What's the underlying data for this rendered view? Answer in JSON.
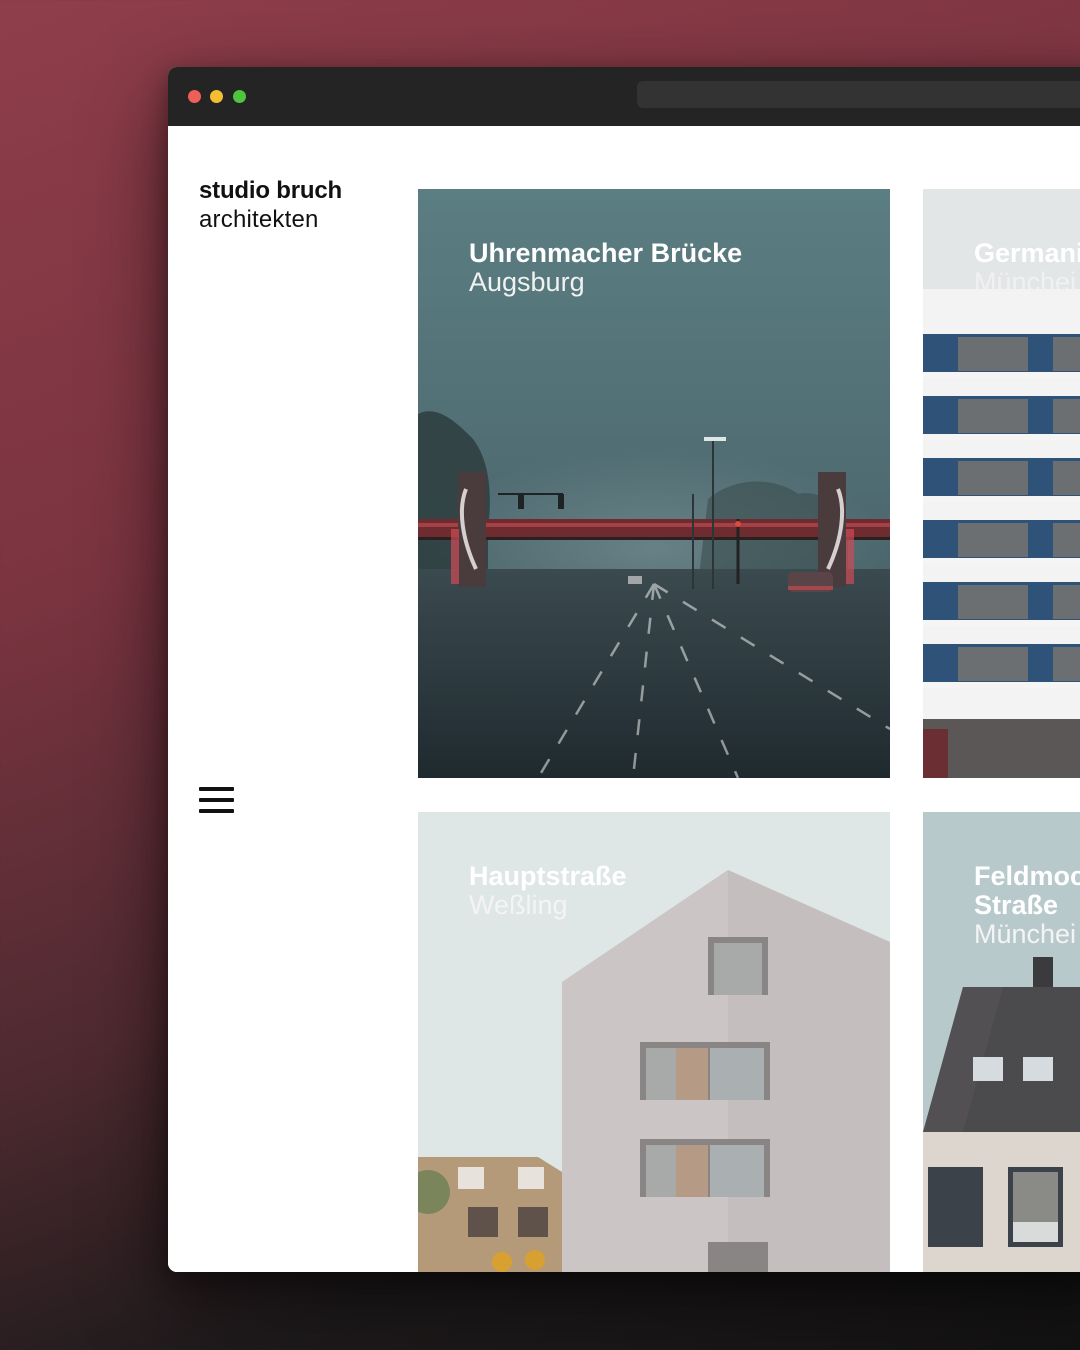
{
  "browser": {
    "traffic_lights": [
      "close",
      "minimize",
      "zoom"
    ],
    "colors": {
      "close": "#ee5f57",
      "minimize": "#f5bd30",
      "zoom": "#4ec43f",
      "chrome": "#242424"
    }
  },
  "brand": {
    "line1": "studio bruch",
    "line2": "architekten"
  },
  "menu": {
    "icon": "hamburger-menu-icon"
  },
  "projects": [
    {
      "title": "Uhrenmacher Brücke",
      "city": "Augsburg",
      "text_color": "#ffffff"
    },
    {
      "title": "Germani",
      "city": "Münchei",
      "text_color": "#ffffff"
    },
    {
      "title": "Hauptstraße",
      "city": "Weßling",
      "text_color": "#ffffff"
    },
    {
      "title": "Feldmoc Straße",
      "city": "Münchei",
      "text_color": "#ffffff"
    }
  ]
}
